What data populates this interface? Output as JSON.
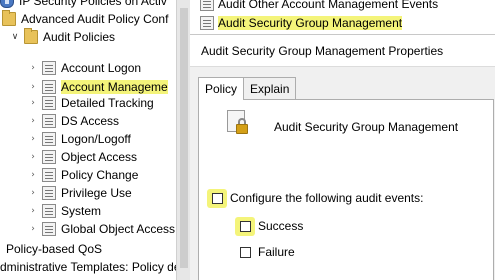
{
  "tree": {
    "items": [
      {
        "label": "IP Security Policies on Activ",
        "icon": "shield-icon",
        "chevron": ""
      },
      {
        "label": "Advanced Audit Policy Conf",
        "icon": "folder-icon",
        "chevron": ""
      },
      {
        "label": "Audit Policies",
        "icon": "folder-icon",
        "chevron": "down"
      },
      {
        "label": "Account Logon",
        "icon": "policy-doc-icon",
        "chevron": "right"
      },
      {
        "label": "Account Manageme",
        "icon": "policy-doc-icon",
        "chevron": "right",
        "highlighted": true
      },
      {
        "label": "Detailed Tracking",
        "icon": "policy-doc-icon",
        "chevron": "right"
      },
      {
        "label": "DS Access",
        "icon": "policy-doc-icon",
        "chevron": "right"
      },
      {
        "label": "Logon/Logoff",
        "icon": "policy-doc-icon",
        "chevron": "right"
      },
      {
        "label": "Object Access",
        "icon": "policy-doc-icon",
        "chevron": "right"
      },
      {
        "label": "Policy Change",
        "icon": "policy-doc-icon",
        "chevron": "right"
      },
      {
        "label": "Privilege Use",
        "icon": "policy-doc-icon",
        "chevron": "right"
      },
      {
        "label": "System",
        "icon": "policy-doc-icon",
        "chevron": "right"
      },
      {
        "label": "Global Object Access",
        "icon": "policy-doc-icon",
        "chevron": "right"
      },
      {
        "label": "Policy-based QoS",
        "icon": "",
        "chevron": ""
      },
      {
        "label": "dministrative Templates: Policy de",
        "icon": "",
        "chevron": ""
      }
    ]
  },
  "list": {
    "items": [
      {
        "label": "Audit Other Account Management Events"
      },
      {
        "label": "Audit Security Group Management",
        "highlighted": true
      }
    ]
  },
  "dialog": {
    "title": "Audit Security Group Management Properties",
    "tabs": [
      {
        "label": "Policy",
        "active": true
      },
      {
        "label": "Explain",
        "active": false
      }
    ],
    "policy_name": "Audit Security Group Management",
    "configure_label": "Configure the following audit events:",
    "configure_checked": false,
    "success_label": "Success",
    "success_checked": false,
    "failure_label": "Failure",
    "failure_checked": false
  },
  "colors": {
    "highlight": "#f4f47a"
  }
}
